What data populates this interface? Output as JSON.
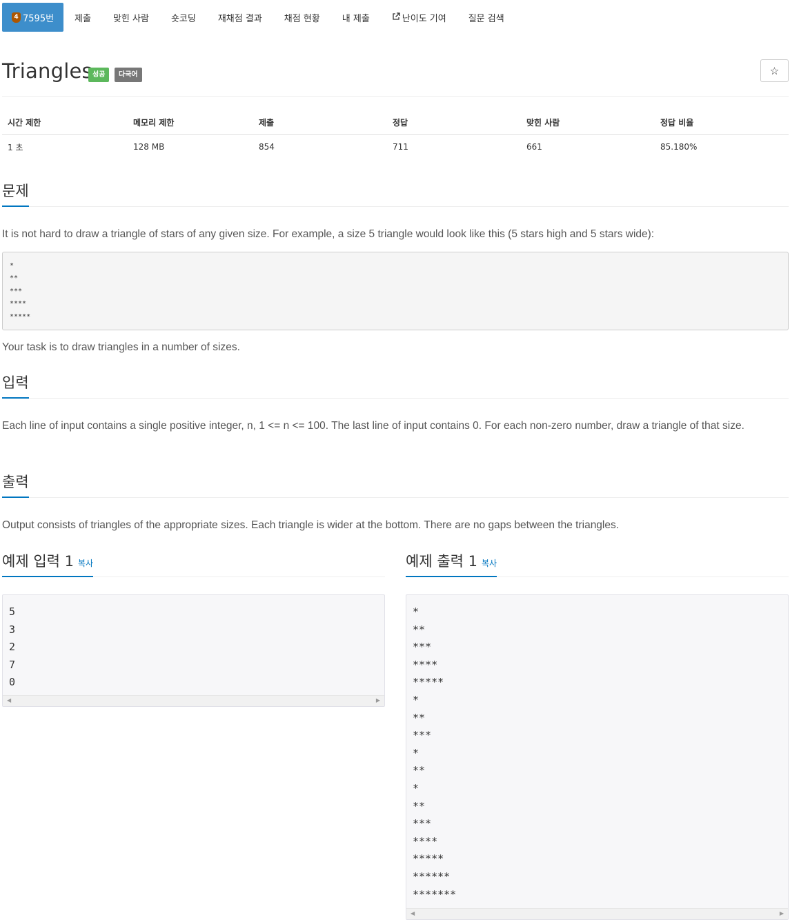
{
  "nav": {
    "problem_tier": "4",
    "problem_number": "7595번",
    "items": [
      "제출",
      "맞힌 사람",
      "숏코딩",
      "재채점 결과",
      "채점 현황",
      "내 제출"
    ],
    "difficulty": "난이도 기여",
    "qna": "질문 검색"
  },
  "problem": {
    "title": "Triangles",
    "label_success": "성공",
    "label_multilang": "다국어",
    "star": "☆"
  },
  "info": {
    "headers": [
      "시간 제한",
      "메모리 제한",
      "제출",
      "정답",
      "맞힌 사람",
      "정답 비율"
    ],
    "values": [
      "1 초",
      "128 MB",
      "854",
      "711",
      "661",
      "85.180%"
    ]
  },
  "sections": {
    "problem": "문제",
    "input": "입력",
    "output": "출력"
  },
  "description": {
    "intro": "It is not hard to draw a triangle of stars of any given size. For example, a size 5 triangle would look like this (5 stars high and 5 stars wide):",
    "example": "*\n**\n***\n****\n*****",
    "task": "Your task is to draw triangles in a number of sizes."
  },
  "input_text": "Each line of input contains a single positive integer, n, 1 <= n <= 100. The last line of input contains 0. For each non-zero number, draw a triangle of that size.",
  "output_text": "Output consists of triangles of the appropriate sizes. Each triangle is wider at the bottom. There are no gaps between the triangles.",
  "samples": {
    "input_title": "예제 입력 1",
    "output_title": "예제 출력 1",
    "copy": "복사",
    "input": "5\n3\n2\n7\n0",
    "output": "*\n**\n***\n****\n*****\n*\n**\n***\n*\n**\n*\n**\n***\n****\n*****\n******\n*******"
  }
}
